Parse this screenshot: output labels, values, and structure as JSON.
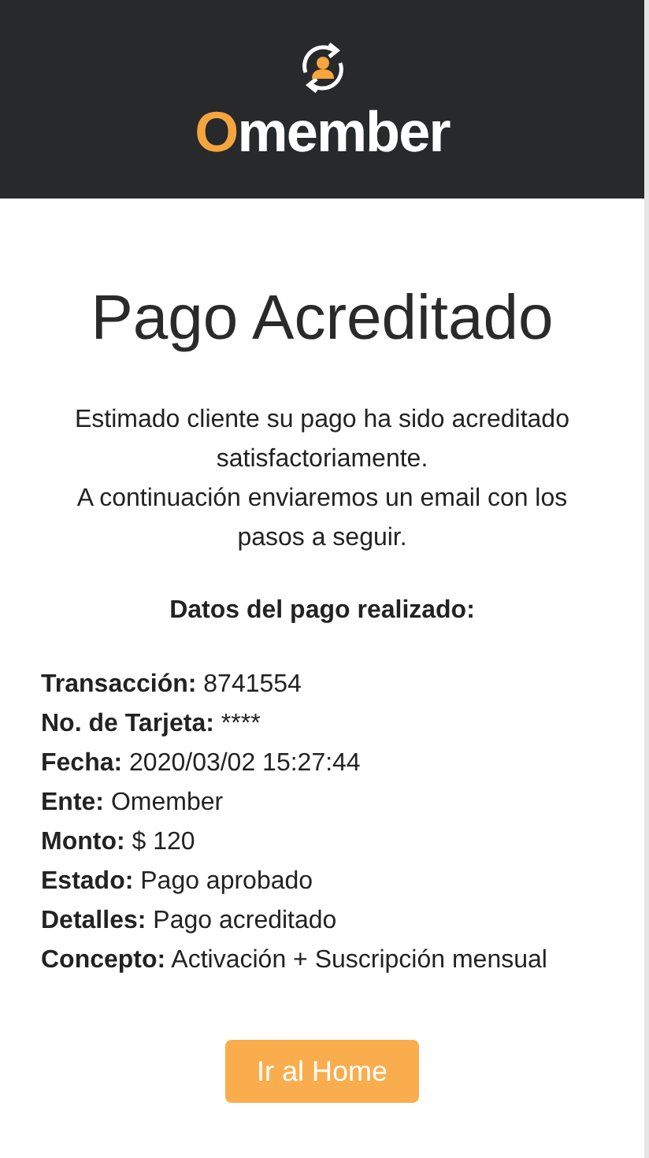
{
  "header": {
    "logo_text": "Omember"
  },
  "title": "Pago Acreditado",
  "message": [
    "Estimado cliente su pago ha sido acreditado satisfactoriamente.",
    "A continuación enviaremos un email con los pasos a seguir."
  ],
  "details_heading": "Datos del pago realizado:",
  "details": [
    "**Transacción:** 8741554",
    "**No. de Tarjeta:** ****",
    "**Fecha:** 2020/03/02 15:27:44",
    "**Ente:** Omember",
    "**Monto:** $ 120",
    "**Estado:** Pago aprobado",
    "**Detalles:** Pago acreditado",
    "**Concepto:** Activación + Suscripción mensual"
  ],
  "button": "Ir al Home"
}
